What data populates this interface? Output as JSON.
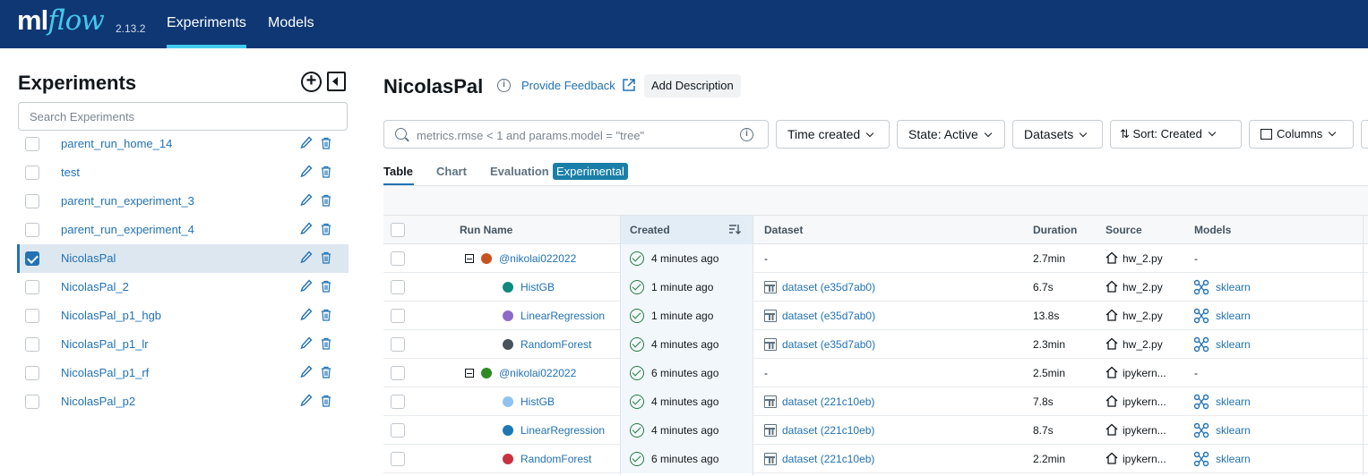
{
  "topbar": {
    "logo_ml": "ml",
    "logo_flow": "flow",
    "version": "2.13.2",
    "tabs": [
      {
        "label": "Experiments",
        "active": true
      },
      {
        "label": "Models",
        "active": false
      }
    ]
  },
  "sidebar": {
    "title": "Experiments",
    "search_placeholder": "Search Experiments",
    "items": [
      {
        "name": "parent_run_home_14",
        "checked": false
      },
      {
        "name": "test",
        "checked": false
      },
      {
        "name": "parent_run_experiment_3",
        "checked": false
      },
      {
        "name": "parent_run_experiment_4",
        "checked": false
      },
      {
        "name": "NicolasPal",
        "checked": true
      },
      {
        "name": "NicolasPal_2",
        "checked": false
      },
      {
        "name": "NicolasPal_p1_hgb",
        "checked": false
      },
      {
        "name": "NicolasPal_p1_lr",
        "checked": false
      },
      {
        "name": "NicolasPal_p1_rf",
        "checked": false
      },
      {
        "name": "NicolasPal_p2",
        "checked": false
      }
    ]
  },
  "main": {
    "title": "NicolasPal",
    "info_icon": "i",
    "feedback_label": "Provide Feedback",
    "add_description_label": "Add Description",
    "search_placeholder": "metrics.rmse < 1 and params.model = \"tree\"",
    "filters": {
      "time_created": "Time created",
      "state": "State: Active",
      "datasets": "Datasets",
      "sort": "Sort: Created",
      "columns": "Columns"
    },
    "view_tabs": {
      "table": "Table",
      "chart": "Chart",
      "evaluation": "Evaluation",
      "experimental": "Experimental"
    },
    "columns": {
      "run_name": "Run Name",
      "created": "Created",
      "dataset": "Dataset",
      "duration": "Duration",
      "source": "Source",
      "models": "Models"
    },
    "runs": [
      {
        "name": "@nikolai022022",
        "parent": true,
        "color": "#c8531e",
        "created": "4 minutes ago",
        "dataset": "-",
        "duration": "2.7min",
        "source": "hw_2.py",
        "model": "-"
      },
      {
        "name": "HistGB",
        "parent": false,
        "color": "#0f8a7e",
        "created": "1 minute ago",
        "dataset": "dataset (e35d7ab0)",
        "duration": "6.7s",
        "source": "hw_2.py",
        "model": "sklearn"
      },
      {
        "name": "LinearRegression",
        "parent": false,
        "color": "#8c6bc8",
        "created": "1 minute ago",
        "dataset": "dataset (e35d7ab0)",
        "duration": "13.8s",
        "source": "hw_2.py",
        "model": "sklearn"
      },
      {
        "name": "RandomForest",
        "parent": false,
        "color": "#4b5158",
        "created": "4 minutes ago",
        "dataset": "dataset (e35d7ab0)",
        "duration": "2.3min",
        "source": "hw_2.py",
        "model": "sklearn"
      },
      {
        "name": "@nikolai022022",
        "parent": true,
        "color": "#2e8b23",
        "created": "6 minutes ago",
        "dataset": "-",
        "duration": "2.5min",
        "source": "ipykern...",
        "model": "-"
      },
      {
        "name": "HistGB",
        "parent": false,
        "color": "#8fc3ee",
        "created": "4 minutes ago",
        "dataset": "dataset (221c10eb)",
        "duration": "7.8s",
        "source": "ipykern...",
        "model": "sklearn"
      },
      {
        "name": "LinearRegression",
        "parent": false,
        "color": "#1c79b4",
        "created": "4 minutes ago",
        "dataset": "dataset (221c10eb)",
        "duration": "8.7s",
        "source": "ipykern...",
        "model": "sklearn"
      },
      {
        "name": "RandomForest",
        "parent": false,
        "color": "#c8323f",
        "created": "6 minutes ago",
        "dataset": "dataset (221c10eb)",
        "duration": "2.2min",
        "source": "ipykern...",
        "model": "sklearn"
      }
    ]
  }
}
